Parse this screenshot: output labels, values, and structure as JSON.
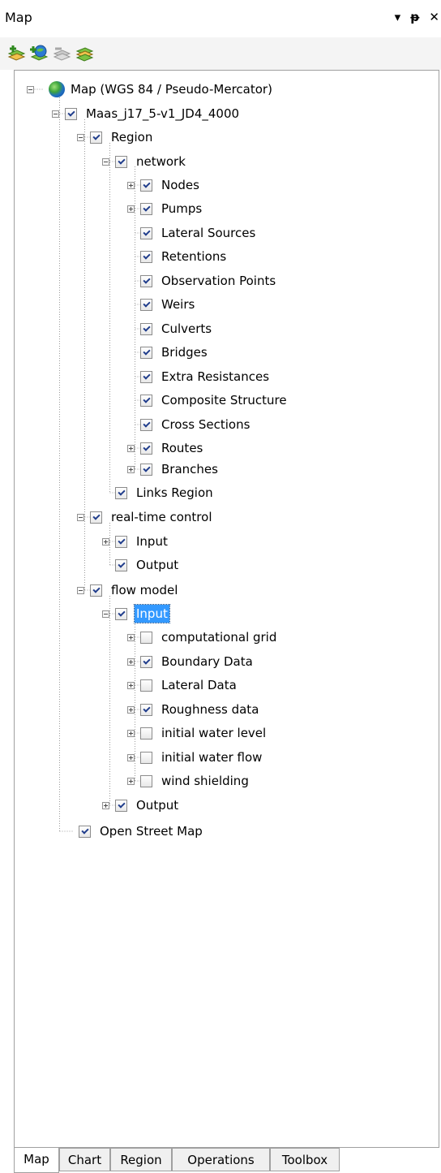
{
  "window": {
    "title": "Map",
    "buttons": [
      "▾",
      "ᵽ",
      "✕"
    ]
  },
  "toolbar": {
    "buttons": [
      {
        "name": "add-layer-button",
        "icon": "add-layer-icon"
      },
      {
        "name": "add-wms-layer-button",
        "icon": "add-globe-layer-icon"
      },
      {
        "name": "remove-layer-button",
        "icon": "remove-layer-icon",
        "disabled": true
      },
      {
        "name": "zoom-to-layer-button",
        "icon": "zoom-layer-icon"
      }
    ]
  },
  "tree": {
    "root": "Map (WGS 84 / Pseudo-Mercator)",
    "items": [
      {
        "label": "Maas_j17_5-v1_JD4_4000",
        "checked": true
      },
      {
        "label": "Region",
        "checked": true
      },
      {
        "label": "network",
        "checked": true
      },
      {
        "label": "Nodes",
        "checked": true
      },
      {
        "label": "Pumps",
        "checked": true
      },
      {
        "label": "Lateral Sources",
        "checked": true
      },
      {
        "label": "Retentions",
        "checked": true
      },
      {
        "label": "Observation Points",
        "checked": true
      },
      {
        "label": "Weirs",
        "checked": true
      },
      {
        "label": "Culverts",
        "checked": true
      },
      {
        "label": "Bridges",
        "checked": true
      },
      {
        "label": "Extra Resistances",
        "checked": true
      },
      {
        "label": "Composite Structure",
        "checked": true
      },
      {
        "label": "Cross Sections",
        "checked": true
      },
      {
        "label": "Routes",
        "checked": true
      },
      {
        "label": "Branches",
        "checked": true
      },
      {
        "label": "Links Region",
        "checked": true
      },
      {
        "label": "real-time control",
        "checked": true
      },
      {
        "label": "Input",
        "checked": true
      },
      {
        "label": "Output",
        "checked": true
      },
      {
        "label": "flow model",
        "checked": true
      },
      {
        "label": "Input",
        "checked": true,
        "selected": true
      },
      {
        "label": "computational grid",
        "checked": false
      },
      {
        "label": "Boundary Data",
        "checked": true
      },
      {
        "label": "Lateral Data",
        "checked": false
      },
      {
        "label": "Roughness data",
        "checked": true
      },
      {
        "label": "initial water level",
        "checked": false
      },
      {
        "label": "initial water flow",
        "checked": false
      },
      {
        "label": "wind shielding",
        "checked": false
      },
      {
        "label": "Output",
        "checked": true
      },
      {
        "label": "Open Street Map",
        "checked": true
      }
    ]
  },
  "tabs": [
    "Map",
    "Chart",
    "Region",
    "Operations",
    "Toolbox"
  ],
  "active_tab": "Map",
  "colors": {
    "selection": "#3399ff",
    "check": "#203d8c",
    "border": "#a0a0a0"
  }
}
